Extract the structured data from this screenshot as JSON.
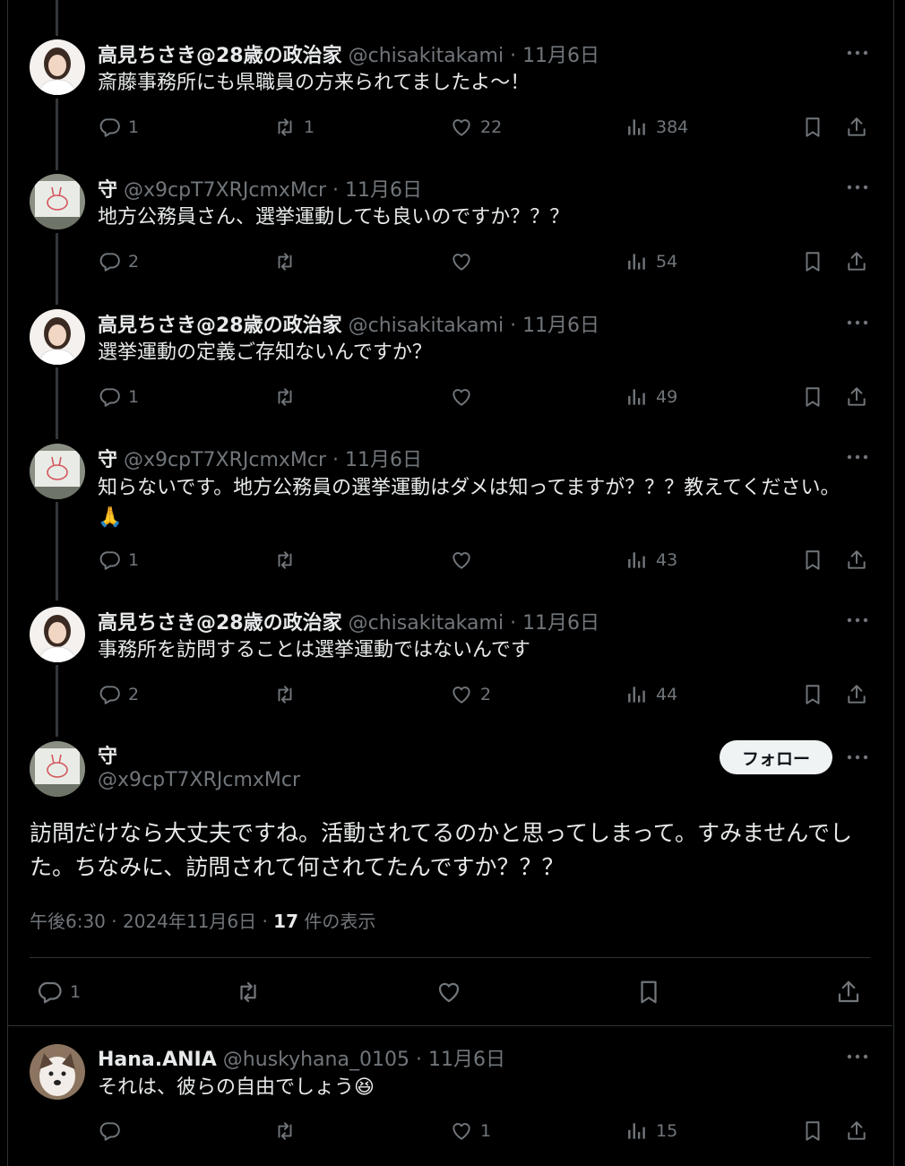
{
  "posts": [
    {
      "name": "高見ちさき@28歳の政治家",
      "handle": "@chisakitakami",
      "sep": "·",
      "date": "11月6日",
      "text": "斎藤事務所にも県職員の方来られてましたよ〜！",
      "replies": "1",
      "reposts": "1",
      "likes": "22",
      "views": "384"
    },
    {
      "name": "守",
      "handle": "@x9cpT7XRJcmxMcr",
      "sep": "·",
      "date": "11月6日",
      "text": "地方公務員さん、選挙運動しても良いのですか？？？",
      "replies": "2",
      "reposts": "",
      "likes": "",
      "views": "54"
    },
    {
      "name": "高見ちさき@28歳の政治家",
      "handle": "@chisakitakami",
      "sep": "·",
      "date": "11月6日",
      "text": "選挙運動の定義ご存知ないんですか？",
      "replies": "1",
      "reposts": "",
      "likes": "",
      "views": "49"
    },
    {
      "name": "守",
      "handle": "@x9cpT7XRJcmxMcr",
      "sep": "·",
      "date": "11月6日",
      "text": "知らないです。地方公務員の選挙運動はダメは知ってますが？？？教えてください。",
      "emoji": "🙏",
      "replies": "1",
      "reposts": "",
      "likes": "",
      "views": "43"
    },
    {
      "name": "高見ちさき@28歳の政治家",
      "handle": "@chisakitakami",
      "sep": "·",
      "date": "11月6日",
      "text": "事務所を訪問することは選挙運動ではないんです",
      "replies": "2",
      "reposts": "",
      "likes": "2",
      "views": "44"
    }
  ],
  "focus": {
    "name": "守",
    "handle": "@x9cpT7XRJcmxMcr",
    "follow_label": "フォロー",
    "text": "訪問だけなら大丈夫ですね。活動されてるのかと思ってしまって。すみませんでした。ちなみに、訪問されて何されてたんですか？？？",
    "time": "午後6:30",
    "sep": "·",
    "date": "2024年11月6日",
    "sep2": "·",
    "views_count": "17",
    "views_label": "件の表示",
    "replies": "1"
  },
  "reply": {
    "name": "Hana.ANIA",
    "handle": "@huskyhana_0105",
    "sep": "·",
    "date": "11月6日",
    "text": "それは、彼らの自由でしょう",
    "emoji": "😆",
    "replies": "",
    "reposts": "",
    "likes": "1",
    "views": "15"
  },
  "icons": [
    "reply-icon",
    "repost-icon",
    "like-icon",
    "views-icon",
    "bookmark-icon",
    "share-icon",
    "more-icon"
  ],
  "colors": {
    "background": "#000000",
    "text": "#e7e9ea",
    "muted": "#71767b",
    "border": "#2f3336",
    "follow_bg": "#eff3f4"
  }
}
